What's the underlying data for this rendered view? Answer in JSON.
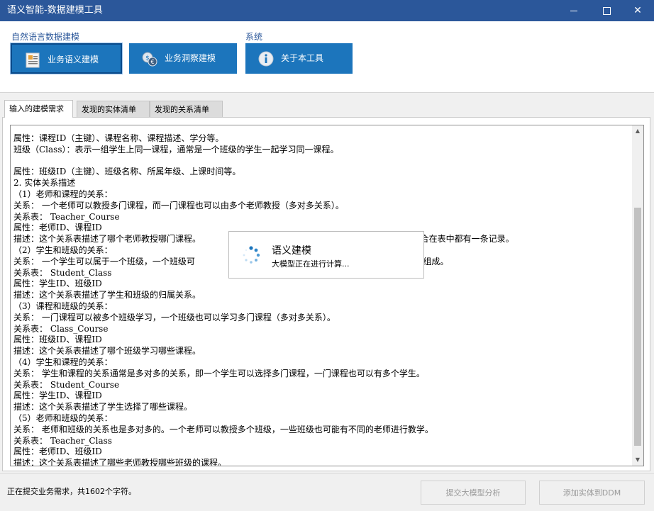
{
  "window": {
    "title": "语义智能-数据建模工具",
    "controls": {
      "minimize": "minimize",
      "maximize": "maximize",
      "close": "✕"
    }
  },
  "ribbon": {
    "groups": [
      {
        "label": "自然语言数据建模",
        "buttons": [
          {
            "label": "业务语义建模",
            "icon": "document-icon",
            "selected": true
          },
          {
            "label": "业务洞察建模",
            "icon": "coins-icon",
            "selected": false
          }
        ]
      },
      {
        "label": "系统",
        "buttons": [
          {
            "label": "关于本工具",
            "icon": "info-icon",
            "selected": false
          }
        ]
      }
    ]
  },
  "tabs": [
    {
      "label": "输入的建模需求",
      "active": true
    },
    {
      "label": "发现的实体清单",
      "active": false
    },
    {
      "label": "发现的关系清单",
      "active": false
    }
  ],
  "editor": {
    "lines": [
      "属性：课程ID（主键）、课程名称、课程描述、学分等。",
      "班级（Class）：表示一组学生上同一课程，通常是一个班级的学生一起学习同一课程。",
      "",
      "属性：班级ID（主键）、班级名称、所属年级、上课时间等。",
      "2. 实体关系描述",
      "（1）老师和课程的关系：",
      "关系： 一个老师可以教授多门课程，而一门课程也可以由多个老师教授（多对多关系）。",
      "关系表： Teacher_Course",
      "属性：老师ID、课程ID",
      "描述：这个关系表描述了哪个老师教授哪门课程。                                                        个老师和课程的组合在表中都有一条记录。",
      "（2）学生和班级的关系：",
      "关系： 一个学生可以属于一个班级，一个班级可                                                        常是一个年级的学生组成。",
      "关系表： Student_Class",
      "属性：学生ID、班级ID",
      "描述：这个关系表描述了学生和班级的归属关系。",
      "（3）课程和班级的关系：",
      "关系： 一门课程可以被多个班级学习，一个班级也可以学习多门课程（多对多关系）。",
      "关系表： Class_Course",
      "属性：班级ID、课程ID",
      "描述：这个关系表描述了哪个班级学习哪些课程。",
      "（4）学生和课程的关系：",
      "关系： 学生和课程的关系通常是多对多的关系，即一个学生可以选择多门课程，一门课程也可以有多个学生。",
      "关系表： Student_Course",
      "属性：学生ID、课程ID",
      "描述：这个关系表描述了学生选择了哪些课程。",
      "（5）老师和班级的关系：",
      "关系： 老师和班级的关系也是多对多的。一个老师可以教授多个班级，一些班级也可能有不同的老师进行教学。",
      "关系表： Teacher_Class",
      "属性：老师ID、班级ID",
      "描述：这个关系表描述了哪些老师教授哪些班级的课程。"
    ]
  },
  "loading": {
    "title": "语义建模",
    "message": "大模型正在进行计算..."
  },
  "statusbar": {
    "status_text": "正在提交业务需求，共1602个字符。",
    "submit_button": "提交大模型分析",
    "add_button": "添加实体到DDM"
  },
  "colors": {
    "titlebar": "#2b579a",
    "ribbon_button": "#1c75bc",
    "group_label": "#2b579a"
  }
}
